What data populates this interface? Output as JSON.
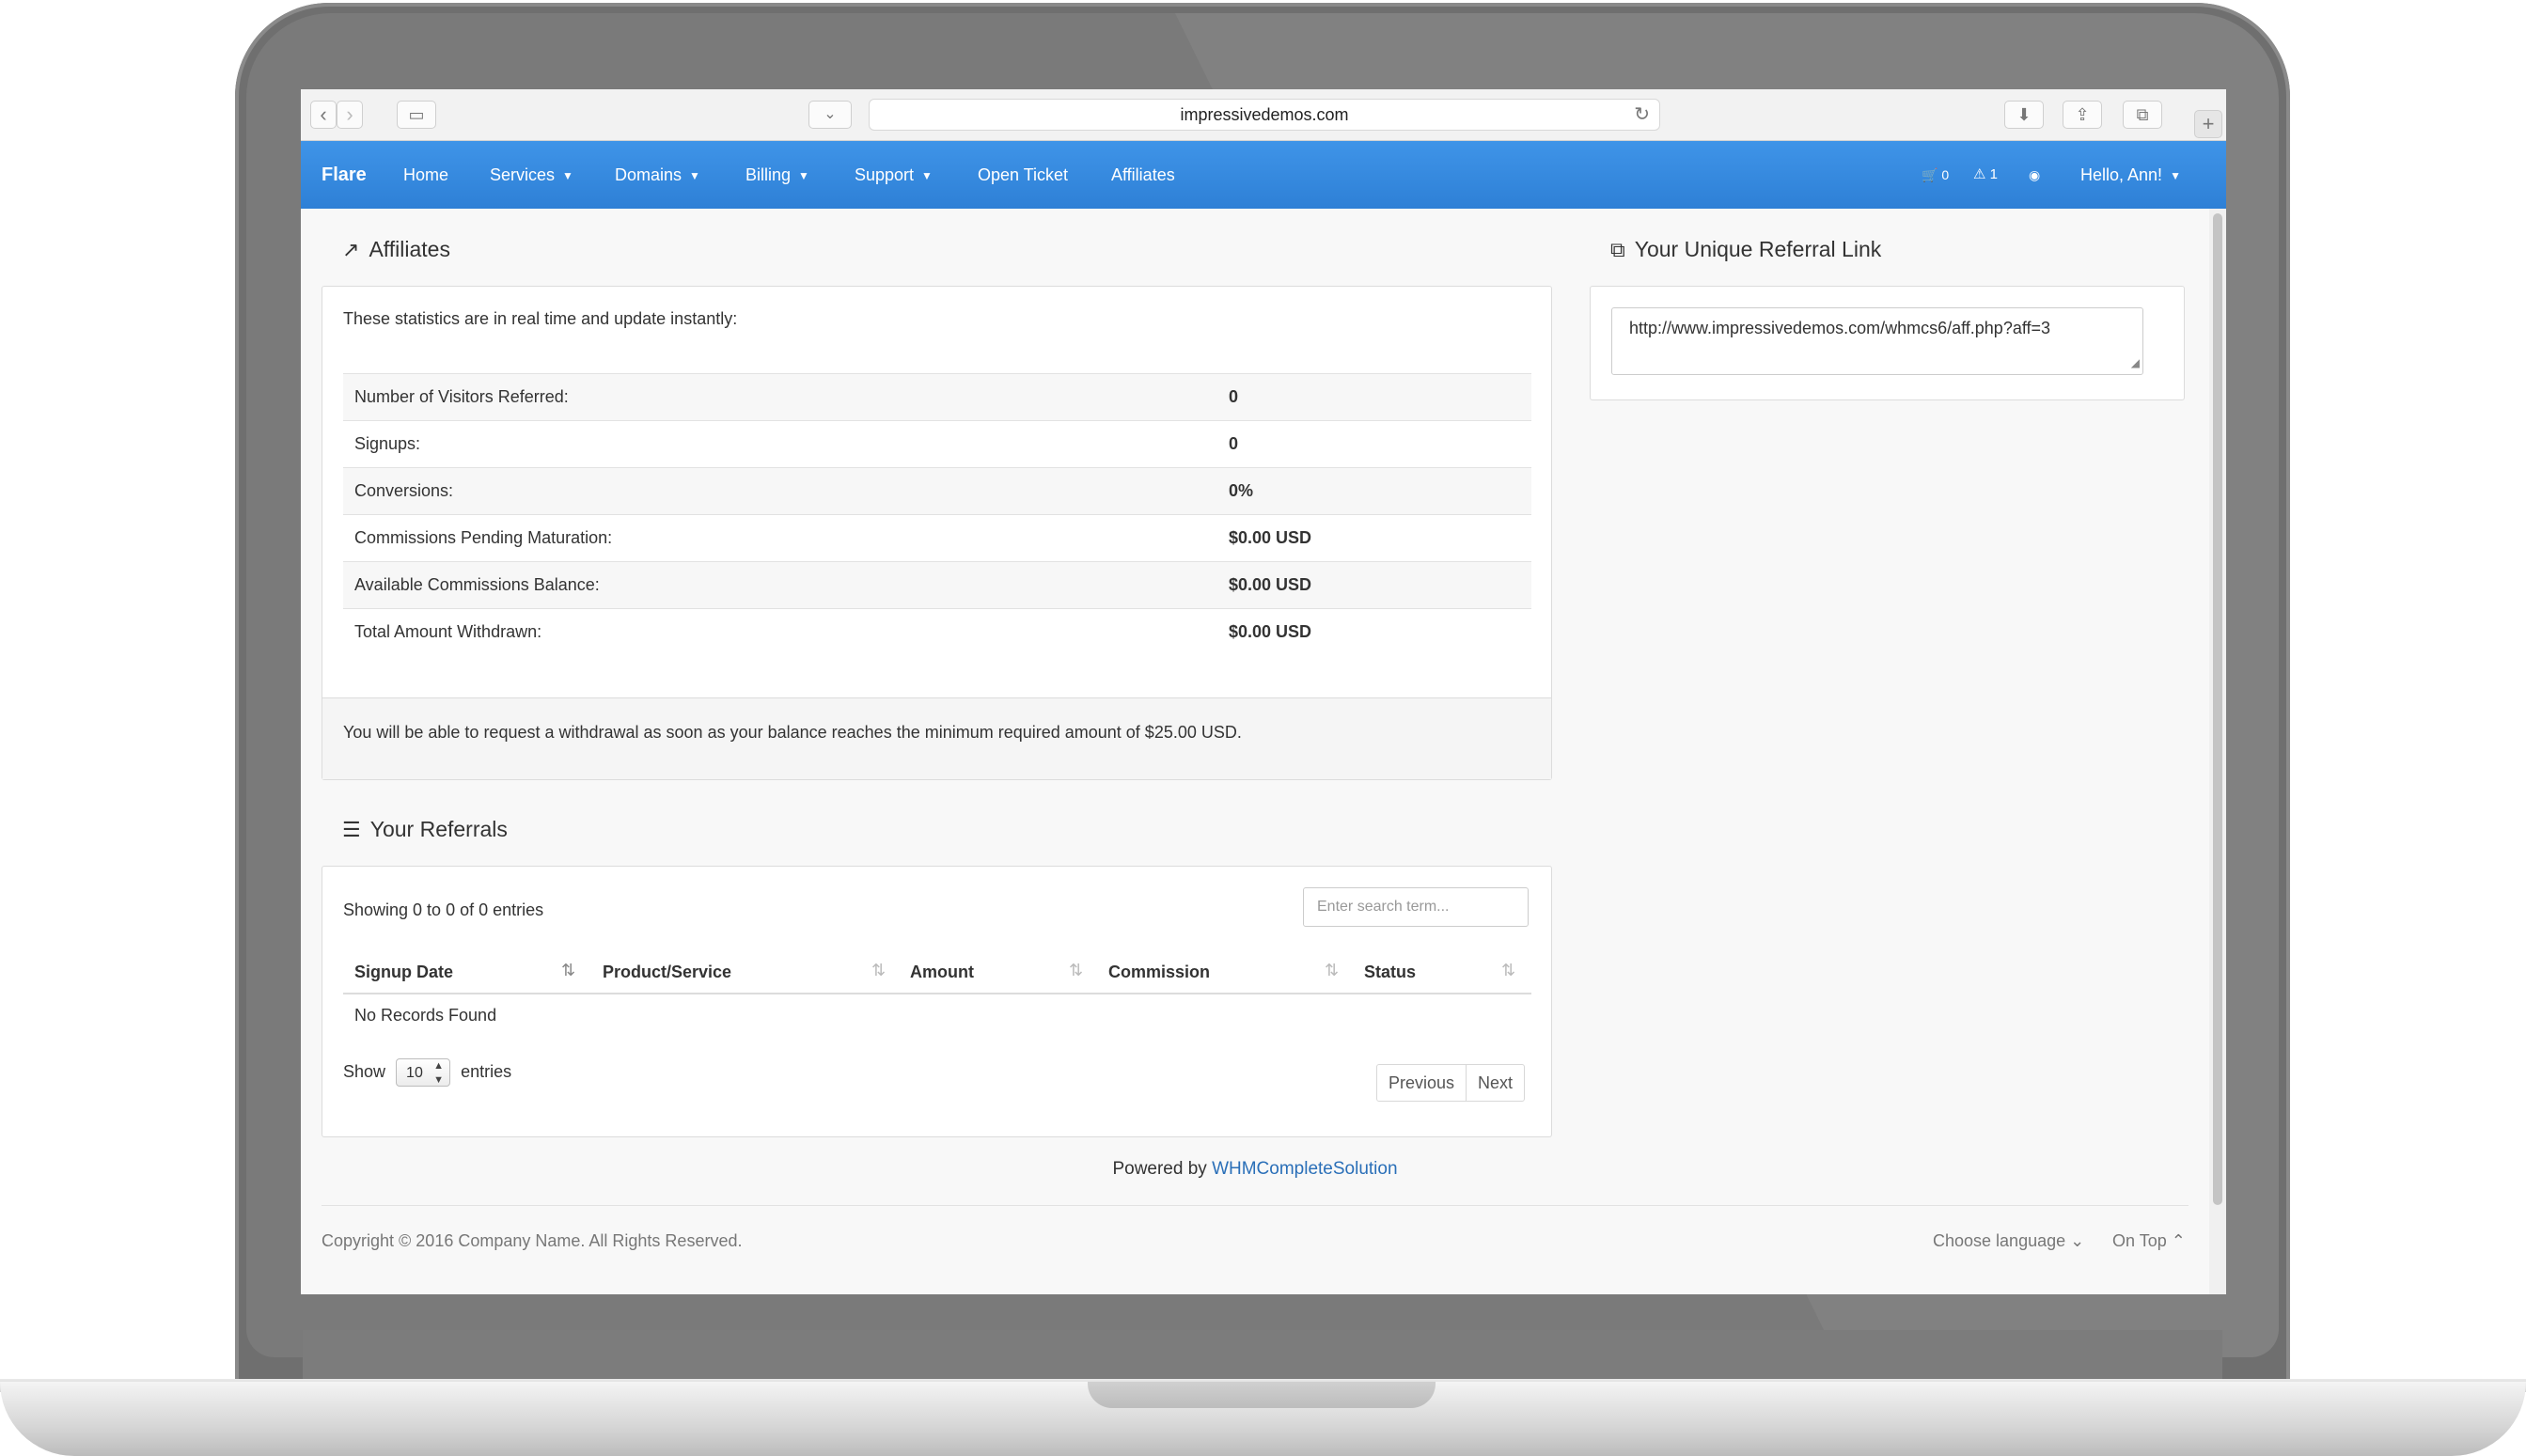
{
  "browser": {
    "url": "impressivedemos.com",
    "back_icon": "‹",
    "forward_icon": "›",
    "sidebar_icon": "▭",
    "pocket_icon": "⌄",
    "reload_icon": "↻",
    "download_icon": "⬇",
    "share_icon": "⇪",
    "tabs_icon": "⧉",
    "new_tab_icon": "+"
  },
  "navbar": {
    "brand": "Flare",
    "items": [
      {
        "label": "Home",
        "dropdown": ""
      },
      {
        "label": "Services",
        "dropdown": "▼"
      },
      {
        "label": "Domains",
        "dropdown": "▼"
      },
      {
        "label": "Billing",
        "dropdown": "▼"
      },
      {
        "label": "Support",
        "dropdown": "▼"
      },
      {
        "label": "Open Ticket",
        "dropdown": ""
      },
      {
        "label": "Affiliates",
        "dropdown": ""
      }
    ],
    "cart_icon": "🛒",
    "cart_count": "0",
    "alert_icon": "⚠",
    "alert_count": "1",
    "status_icon": "◉",
    "user_label": "Hello, Ann!",
    "user_caret": "▼"
  },
  "affiliates": {
    "title": "Affiliates",
    "title_icon": "↗",
    "intro": "These statistics are in real time and update instantly:",
    "stats": [
      {
        "label": "Number of Visitors Referred:",
        "value": "0"
      },
      {
        "label": "Signups:",
        "value": "0"
      },
      {
        "label": "Conversions:",
        "value": "0%"
      },
      {
        "label": "Commissions Pending Maturation:",
        "value": "$0.00 USD"
      },
      {
        "label": "Available Commissions Balance:",
        "value": "$0.00 USD"
      },
      {
        "label": "Total Amount Withdrawn:",
        "value": "$0.00 USD"
      }
    ],
    "withdrawal_note": "You will be able to request a withdrawal as soon as your balance reaches the minimum required amount of $25.00 USD."
  },
  "referral_link": {
    "title": "Your Unique Referral Link",
    "title_icon": "⧉",
    "url": "http://www.impressivedemos.com/whmcs6/aff.php?aff=3"
  },
  "referrals": {
    "title": "Your Referrals",
    "title_icon": "☰",
    "showing": "Showing 0 to 0 of 0 entries",
    "search_placeholder": "Enter search term...",
    "columns": [
      "Signup Date",
      "Product/Service",
      "Amount",
      "Commission",
      "Status"
    ],
    "sort_icon": "⇅",
    "empty": "No Records Found",
    "show_label": "Show",
    "page_length": "10",
    "entries_label": "entries",
    "previous": "Previous",
    "next": "Next"
  },
  "footer": {
    "powered_prefix": "Powered by ",
    "powered_link": "WHMCompleteSolution",
    "copyright": "Copyright © 2016 Company Name. All Rights Reserved.",
    "choose_language": "Choose language",
    "choose_language_icon": "⌄",
    "on_top": "On Top",
    "on_top_icon": "⌃"
  }
}
